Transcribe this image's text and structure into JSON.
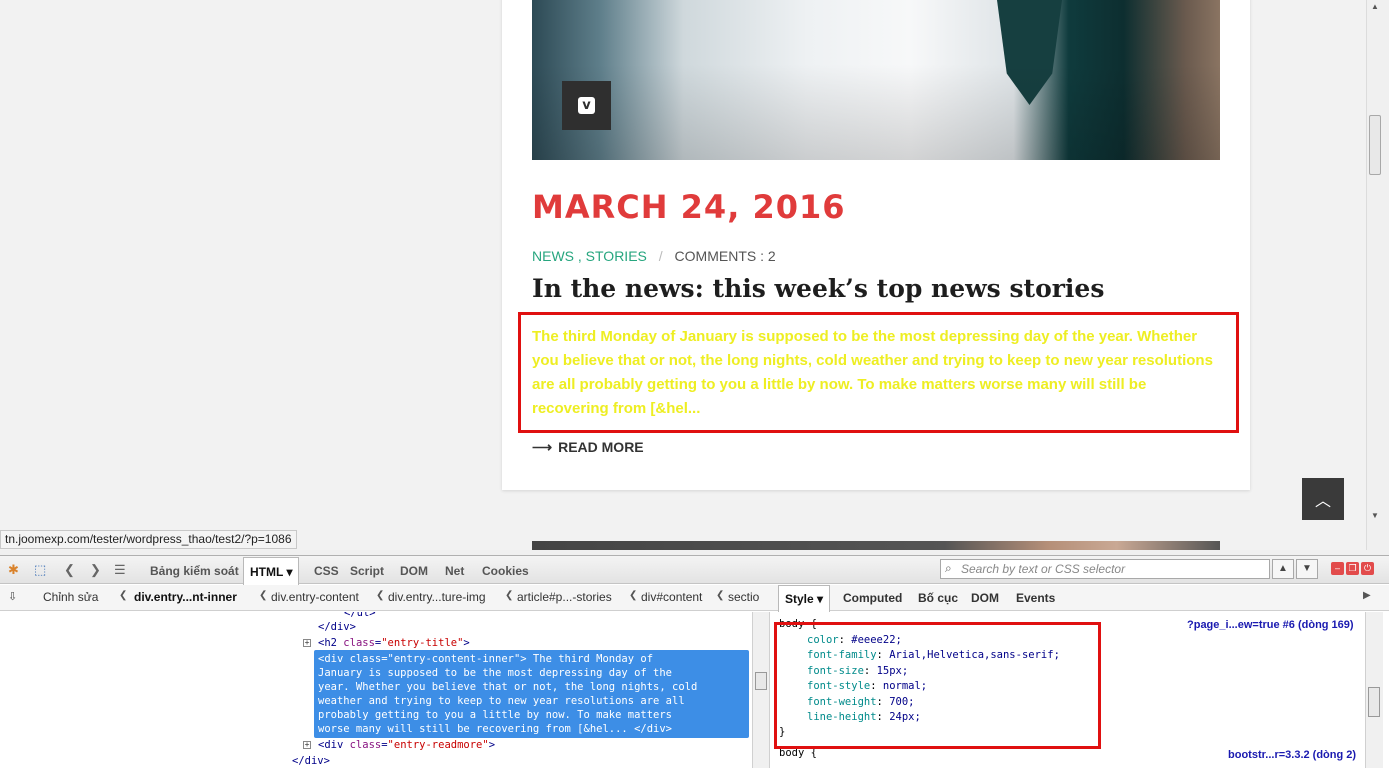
{
  "page": {
    "date": "MARCH 24, 2016",
    "categories": [
      "NEWS",
      "STORIES"
    ],
    "category_sep": ",",
    "meta_sep": "/",
    "comments": "COMMENTS : 2",
    "title": "In the news: this week’s top news stories",
    "excerpt": "The third Monday of January is supposed to be the most depressing day of the year. Whether you believe that or not, the long nights, cold weather and trying to keep to new year resolutions are all probably getting to you a little by now. To make matters worse many will still be recovering from [&hel...",
    "read_more": "READ MORE",
    "read_more_arrow": "⟶",
    "vimeo_glyph": "v",
    "to_top_glyph": "︿",
    "status_url": "tn.joomexp.com/tester/wordpress_thao/test2/?p=1086",
    "colors": {
      "accent_red": "#e03b3b",
      "category_green": "#27a67f",
      "excerpt_yellow": "#eeee22",
      "highlight_box": "#e01010"
    }
  },
  "firebug": {
    "tabs": {
      "console": "Bảng kiểm soát",
      "html": "HTML",
      "css": "CSS",
      "script": "Script",
      "dom": "DOM",
      "net": "Net",
      "cookies": "Cookies"
    },
    "search_placeholder": "Search by text or CSS selector",
    "edit_label": "Chỉnh sửa",
    "breadcrumbs": [
      "div.entry...nt-inner",
      "div.entry-content",
      "div.entry...ture-img",
      "article#p...-stories",
      "div#content",
      "sectio"
    ],
    "side_tabs": {
      "style": "Style",
      "computed": "Computed",
      "layout": "Bố cục",
      "dom": "DOM",
      "events": "Events"
    },
    "html_lines": {
      "l1": "</ul>",
      "l2": "</div>",
      "l3_tag": "<h2 ",
      "l3_attr": "class",
      "l3_val": "\"entry-title\"",
      "l3_end": ">",
      "sel1": "<div class=\"entry-content-inner\">  The third Monday of",
      "sel2": "January is supposed to be the most depressing day of the",
      "sel3": "year. Whether you believe that or not, the long nights, cold",
      "sel4": "weather and trying to keep to new year resolutions are all",
      "sel5": "probably getting to you a little by now. To make matters",
      "sel6": "worse many will still be recovering from [&hel... </div>",
      "l5_tag": "<div ",
      "l5_attr": "class",
      "l5_val": "\"entry-readmore\"",
      "l5_end": ">",
      "l6": "</div>"
    },
    "css_rules": {
      "top_fragment": "",
      "rule1_selector": "body {",
      "rule1_source": "?page_i...ew=true #6 (dòng 169)",
      "props": [
        {
          "name": "color",
          "value": "#eeee22;"
        },
        {
          "name": "font-family",
          "value": "Arial,Helvetica,sans-serif;"
        },
        {
          "name": "font-size",
          "value": "15px;"
        },
        {
          "name": "font-style",
          "value": "normal;"
        },
        {
          "name": "font-weight",
          "value": "700;"
        },
        {
          "name": "line-height",
          "value": "24px;"
        }
      ],
      "rule1_close": "}",
      "rule2_selector": "body {",
      "rule2_source": "bootstr...r=3.3.2 (dòng 2)"
    }
  }
}
